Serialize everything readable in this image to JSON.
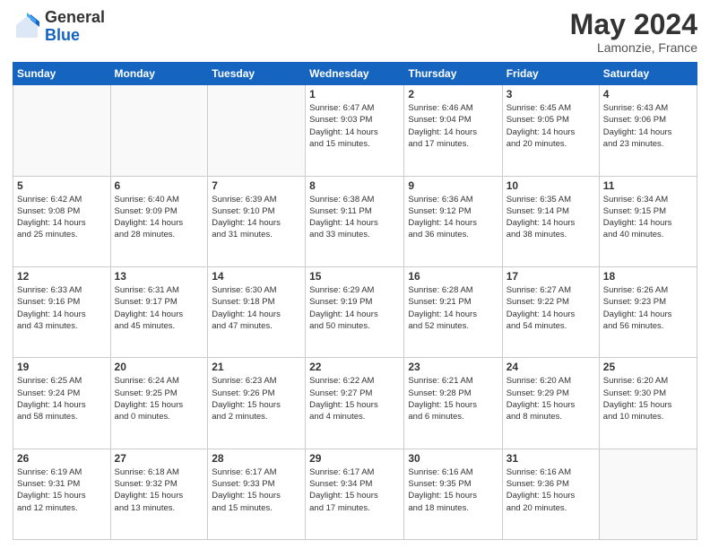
{
  "logo": {
    "general": "General",
    "blue": "Blue"
  },
  "title": "May 2024",
  "location": "Lamonzie, France",
  "days_of_week": [
    "Sunday",
    "Monday",
    "Tuesday",
    "Wednesday",
    "Thursday",
    "Friday",
    "Saturday"
  ],
  "weeks": [
    [
      {
        "day": "",
        "info": ""
      },
      {
        "day": "",
        "info": ""
      },
      {
        "day": "",
        "info": ""
      },
      {
        "day": "1",
        "info": "Sunrise: 6:47 AM\nSunset: 9:03 PM\nDaylight: 14 hours\nand 15 minutes."
      },
      {
        "day": "2",
        "info": "Sunrise: 6:46 AM\nSunset: 9:04 PM\nDaylight: 14 hours\nand 17 minutes."
      },
      {
        "day": "3",
        "info": "Sunrise: 6:45 AM\nSunset: 9:05 PM\nDaylight: 14 hours\nand 20 minutes."
      },
      {
        "day": "4",
        "info": "Sunrise: 6:43 AM\nSunset: 9:06 PM\nDaylight: 14 hours\nand 23 minutes."
      }
    ],
    [
      {
        "day": "5",
        "info": "Sunrise: 6:42 AM\nSunset: 9:08 PM\nDaylight: 14 hours\nand 25 minutes."
      },
      {
        "day": "6",
        "info": "Sunrise: 6:40 AM\nSunset: 9:09 PM\nDaylight: 14 hours\nand 28 minutes."
      },
      {
        "day": "7",
        "info": "Sunrise: 6:39 AM\nSunset: 9:10 PM\nDaylight: 14 hours\nand 31 minutes."
      },
      {
        "day": "8",
        "info": "Sunrise: 6:38 AM\nSunset: 9:11 PM\nDaylight: 14 hours\nand 33 minutes."
      },
      {
        "day": "9",
        "info": "Sunrise: 6:36 AM\nSunset: 9:12 PM\nDaylight: 14 hours\nand 36 minutes."
      },
      {
        "day": "10",
        "info": "Sunrise: 6:35 AM\nSunset: 9:14 PM\nDaylight: 14 hours\nand 38 minutes."
      },
      {
        "day": "11",
        "info": "Sunrise: 6:34 AM\nSunset: 9:15 PM\nDaylight: 14 hours\nand 40 minutes."
      }
    ],
    [
      {
        "day": "12",
        "info": "Sunrise: 6:33 AM\nSunset: 9:16 PM\nDaylight: 14 hours\nand 43 minutes."
      },
      {
        "day": "13",
        "info": "Sunrise: 6:31 AM\nSunset: 9:17 PM\nDaylight: 14 hours\nand 45 minutes."
      },
      {
        "day": "14",
        "info": "Sunrise: 6:30 AM\nSunset: 9:18 PM\nDaylight: 14 hours\nand 47 minutes."
      },
      {
        "day": "15",
        "info": "Sunrise: 6:29 AM\nSunset: 9:19 PM\nDaylight: 14 hours\nand 50 minutes."
      },
      {
        "day": "16",
        "info": "Sunrise: 6:28 AM\nSunset: 9:21 PM\nDaylight: 14 hours\nand 52 minutes."
      },
      {
        "day": "17",
        "info": "Sunrise: 6:27 AM\nSunset: 9:22 PM\nDaylight: 14 hours\nand 54 minutes."
      },
      {
        "day": "18",
        "info": "Sunrise: 6:26 AM\nSunset: 9:23 PM\nDaylight: 14 hours\nand 56 minutes."
      }
    ],
    [
      {
        "day": "19",
        "info": "Sunrise: 6:25 AM\nSunset: 9:24 PM\nDaylight: 14 hours\nand 58 minutes."
      },
      {
        "day": "20",
        "info": "Sunrise: 6:24 AM\nSunset: 9:25 PM\nDaylight: 15 hours\nand 0 minutes."
      },
      {
        "day": "21",
        "info": "Sunrise: 6:23 AM\nSunset: 9:26 PM\nDaylight: 15 hours\nand 2 minutes."
      },
      {
        "day": "22",
        "info": "Sunrise: 6:22 AM\nSunset: 9:27 PM\nDaylight: 15 hours\nand 4 minutes."
      },
      {
        "day": "23",
        "info": "Sunrise: 6:21 AM\nSunset: 9:28 PM\nDaylight: 15 hours\nand 6 minutes."
      },
      {
        "day": "24",
        "info": "Sunrise: 6:20 AM\nSunset: 9:29 PM\nDaylight: 15 hours\nand 8 minutes."
      },
      {
        "day": "25",
        "info": "Sunrise: 6:20 AM\nSunset: 9:30 PM\nDaylight: 15 hours\nand 10 minutes."
      }
    ],
    [
      {
        "day": "26",
        "info": "Sunrise: 6:19 AM\nSunset: 9:31 PM\nDaylight: 15 hours\nand 12 minutes."
      },
      {
        "day": "27",
        "info": "Sunrise: 6:18 AM\nSunset: 9:32 PM\nDaylight: 15 hours\nand 13 minutes."
      },
      {
        "day": "28",
        "info": "Sunrise: 6:17 AM\nSunset: 9:33 PM\nDaylight: 15 hours\nand 15 minutes."
      },
      {
        "day": "29",
        "info": "Sunrise: 6:17 AM\nSunset: 9:34 PM\nDaylight: 15 hours\nand 17 minutes."
      },
      {
        "day": "30",
        "info": "Sunrise: 6:16 AM\nSunset: 9:35 PM\nDaylight: 15 hours\nand 18 minutes."
      },
      {
        "day": "31",
        "info": "Sunrise: 6:16 AM\nSunset: 9:36 PM\nDaylight: 15 hours\nand 20 minutes."
      },
      {
        "day": "",
        "info": ""
      }
    ]
  ]
}
